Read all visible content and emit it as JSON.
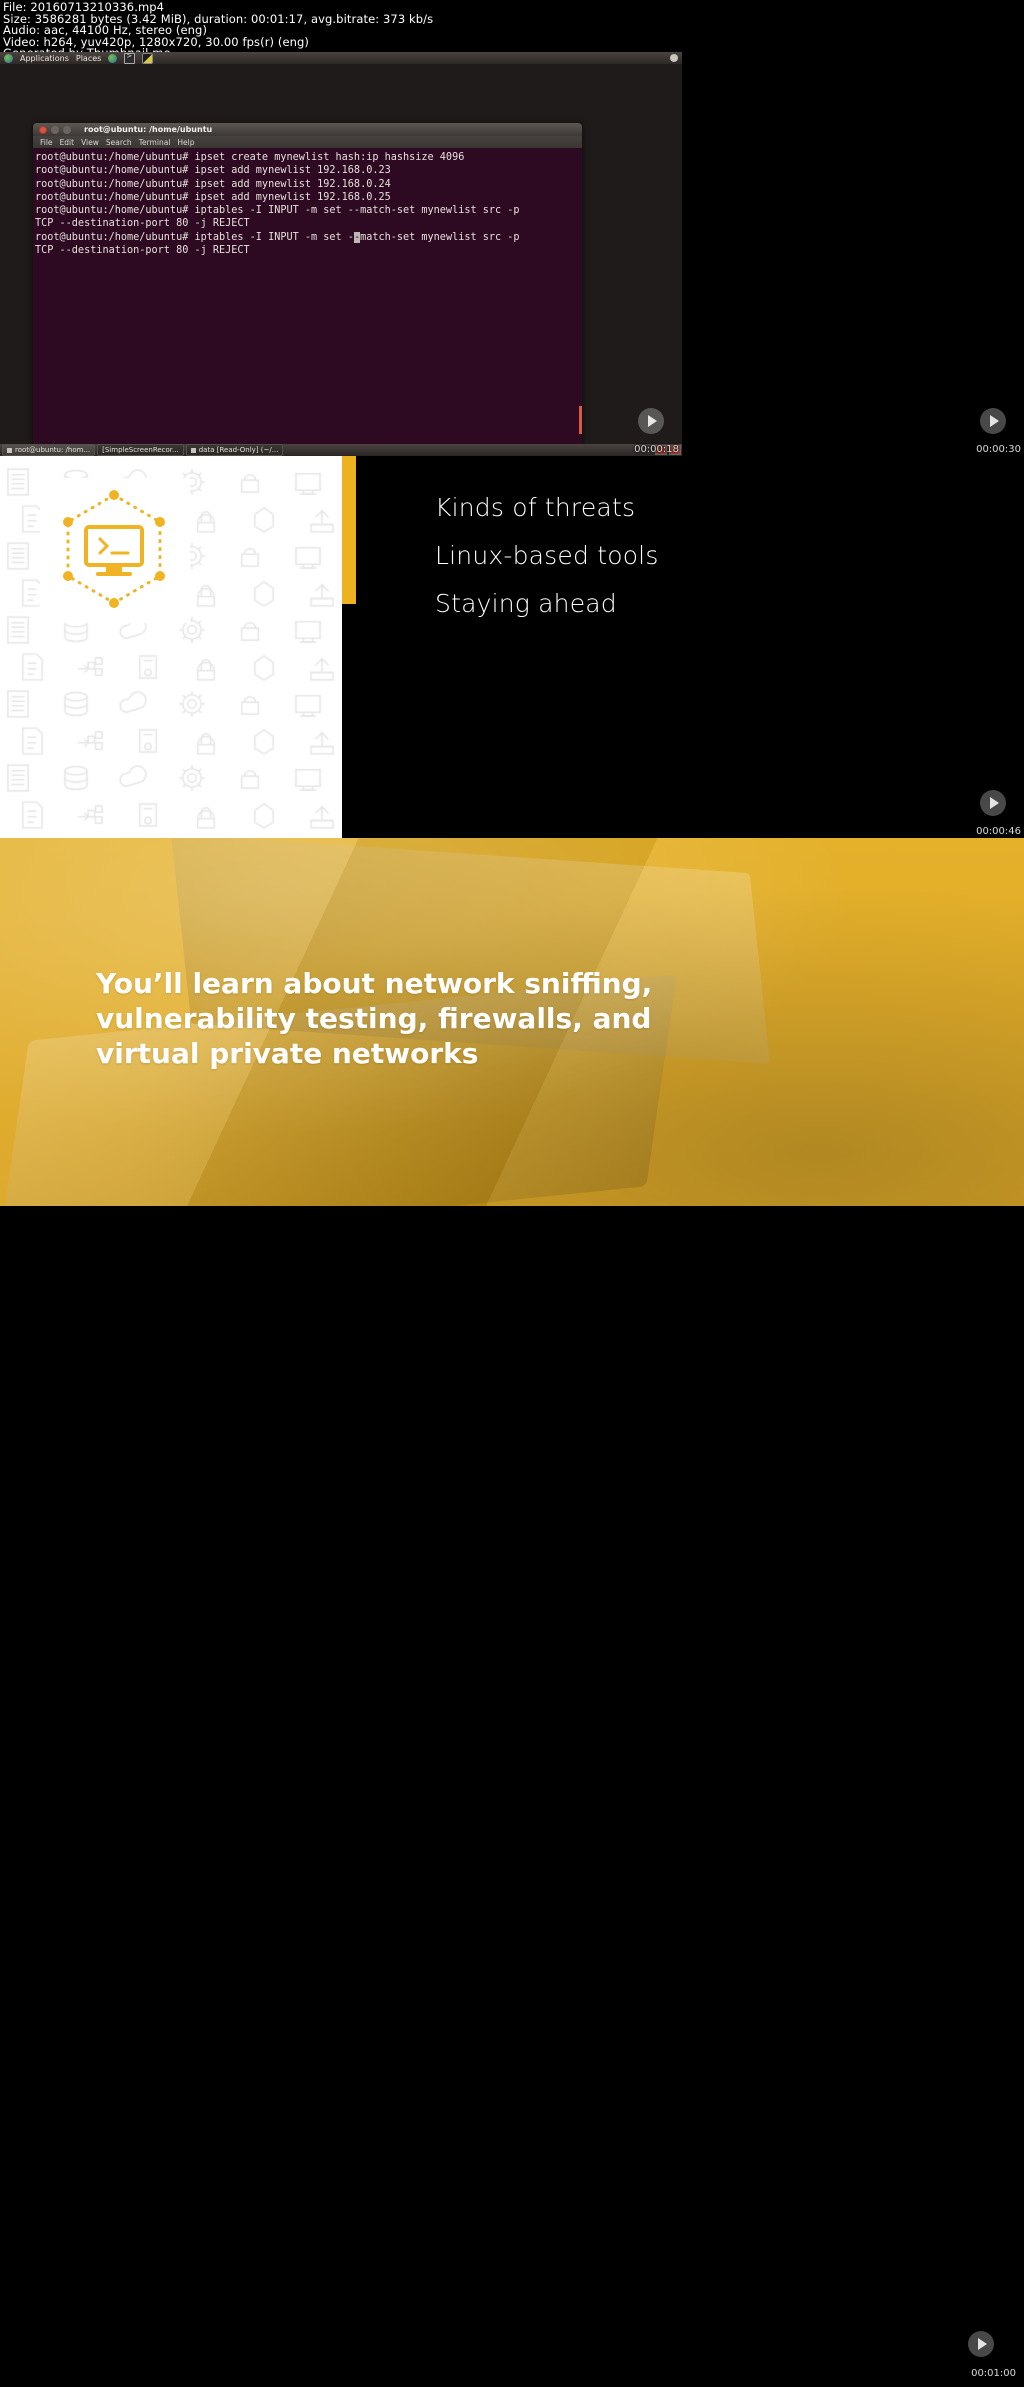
{
  "info": {
    "line_file": "File: 20160713210336.mp4",
    "line_size": "Size: 3586281 bytes (3.42 MiB), duration: 00:01:17, avg.bitrate: 373 kb/s",
    "line_audio": "Audio: aac, 44100 Hz, stereo (eng)",
    "line_video": "Video: h264, yuv420p, 1280x720, 30.00 fps(r) (eng)",
    "line_generator": "Generated by Thumbnail me"
  },
  "frames": [
    {
      "name": "ubuntu-terminal-frame",
      "timestamp": "00:00:18"
    },
    {
      "name": "black-frame",
      "timestamp": "00:00:30"
    },
    {
      "name": "icon-pattern-frame",
      "timestamp": ""
    },
    {
      "name": "bullets-frame",
      "timestamp": "00:00:46"
    },
    {
      "name": "yellow-laptop-frame",
      "timestamp": ""
    },
    {
      "name": "bottom-frame",
      "timestamp": "00:01:00"
    }
  ],
  "desktop": {
    "panel": {
      "applications": "Applications",
      "places": "Places",
      "icons": [
        "globe-icon",
        "terminal-icon",
        "monitor-icon"
      ],
      "user_icon": "user-icon"
    },
    "terminal": {
      "title": "root@ubuntu: /home/ubuntu",
      "menu": [
        "File",
        "Edit",
        "View",
        "Search",
        "Terminal",
        "Help"
      ],
      "prompt": "root@ubuntu:/home/ubuntu#",
      "lines": [
        "root@ubuntu:/home/ubuntu# ipset create mynewlist hash:ip hashsize 4096",
        "root@ubuntu:/home/ubuntu# ipset add mynewlist 192.168.0.23",
        "root@ubuntu:/home/ubuntu# ipset add mynewlist 192.168.0.24",
        "root@ubuntu:/home/ubuntu# ipset add mynewlist 192.168.0.25",
        "root@ubuntu:/home/ubuntu# iptables -I INPUT -m set --match-set mynewlist src -p",
        "TCP --destination-port 80 -j REJECT",
        "root@ubuntu:/home/ubuntu# iptables -I INPUT -m set --match-set mynewlist src -p",
        "TCP --destination-port 80 -j REJECT"
      ],
      "cursor_line_index": 6,
      "cursor_char_index": 52
    },
    "taskbar": {
      "items": [
        "root@ubuntu: /hom...",
        "[SimpleScreenRecor...",
        "data [Read-Only] (~/..."
      ]
    }
  },
  "slide_bullets": {
    "items": [
      "Kinds of threats",
      "Linux-based tools",
      "Staying ahead"
    ]
  },
  "slide_yellow": {
    "text": "You’ll learn about network sniffing, vulnerability testing, firewalls, and virtual private networks"
  },
  "colors": {
    "accent_yellow": "#ecb21f",
    "terminal_bg": "#2d0922",
    "panel_bg": "#2d2926"
  }
}
